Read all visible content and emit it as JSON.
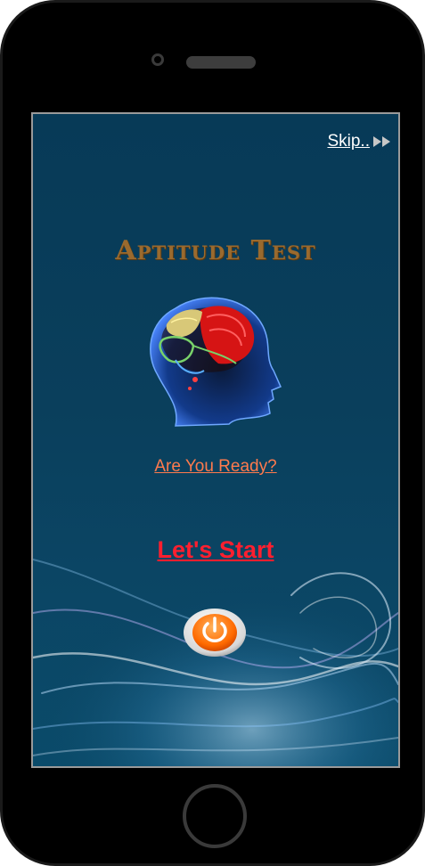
{
  "skip": {
    "label": "Skip.."
  },
  "title": "Aptitude Test",
  "ready_link": "Are You Ready?",
  "start_link": "Let's  Start",
  "icons": {
    "skip": "fast-forward-icon",
    "brain": "brain-head-illustration",
    "power": "power-icon"
  },
  "colors": {
    "screen_bg": "#073a57",
    "title": "#9a6a2e",
    "ready_link": "#ff7a4d",
    "start_link": "#ff1f2f",
    "power_button": "#ff6a00"
  }
}
